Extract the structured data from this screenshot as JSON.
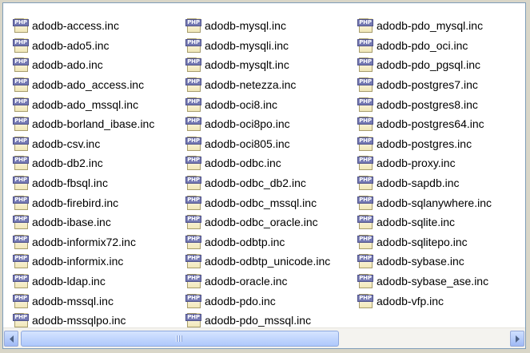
{
  "icon": "php-file-icon",
  "icon_tag": "PHP",
  "columns": [
    [
      "adodb-access.inc",
      "adodb-ado5.inc",
      "adodb-ado.inc",
      "adodb-ado_access.inc",
      "adodb-ado_mssql.inc",
      "adodb-borland_ibase.inc",
      "adodb-csv.inc",
      "adodb-db2.inc",
      "adodb-fbsql.inc",
      "adodb-firebird.inc",
      "adodb-ibase.inc",
      "adodb-informix72.inc",
      "adodb-informix.inc",
      "adodb-ldap.inc",
      "adodb-mssql.inc",
      "adodb-mssqlpo.inc"
    ],
    [
      "adodb-mysql.inc",
      "adodb-mysqli.inc",
      "adodb-mysqlt.inc",
      "adodb-netezza.inc",
      "adodb-oci8.inc",
      "adodb-oci8po.inc",
      "adodb-oci805.inc",
      "adodb-odbc.inc",
      "adodb-odbc_db2.inc",
      "adodb-odbc_mssql.inc",
      "adodb-odbc_oracle.inc",
      "adodb-odbtp.inc",
      "adodb-odbtp_unicode.inc",
      "adodb-oracle.inc",
      "adodb-pdo.inc",
      "adodb-pdo_mssql.inc"
    ],
    [
      "adodb-pdo_mysql.inc",
      "adodb-pdo_oci.inc",
      "adodb-pdo_pgsql.inc",
      "adodb-postgres7.inc",
      "adodb-postgres8.inc",
      "adodb-postgres64.inc",
      "adodb-postgres.inc",
      "adodb-proxy.inc",
      "adodb-sapdb.inc",
      "adodb-sqlanywhere.inc",
      "adodb-sqlite.inc",
      "adodb-sqlitepo.inc",
      "adodb-sybase.inc",
      "adodb-sybase_ase.inc",
      "adodb-vfp.inc"
    ]
  ],
  "scrollbar": {
    "left_button_icon": "arrow-left-icon",
    "right_button_icon": "arrow-right-icon",
    "thumb_position": 0
  }
}
